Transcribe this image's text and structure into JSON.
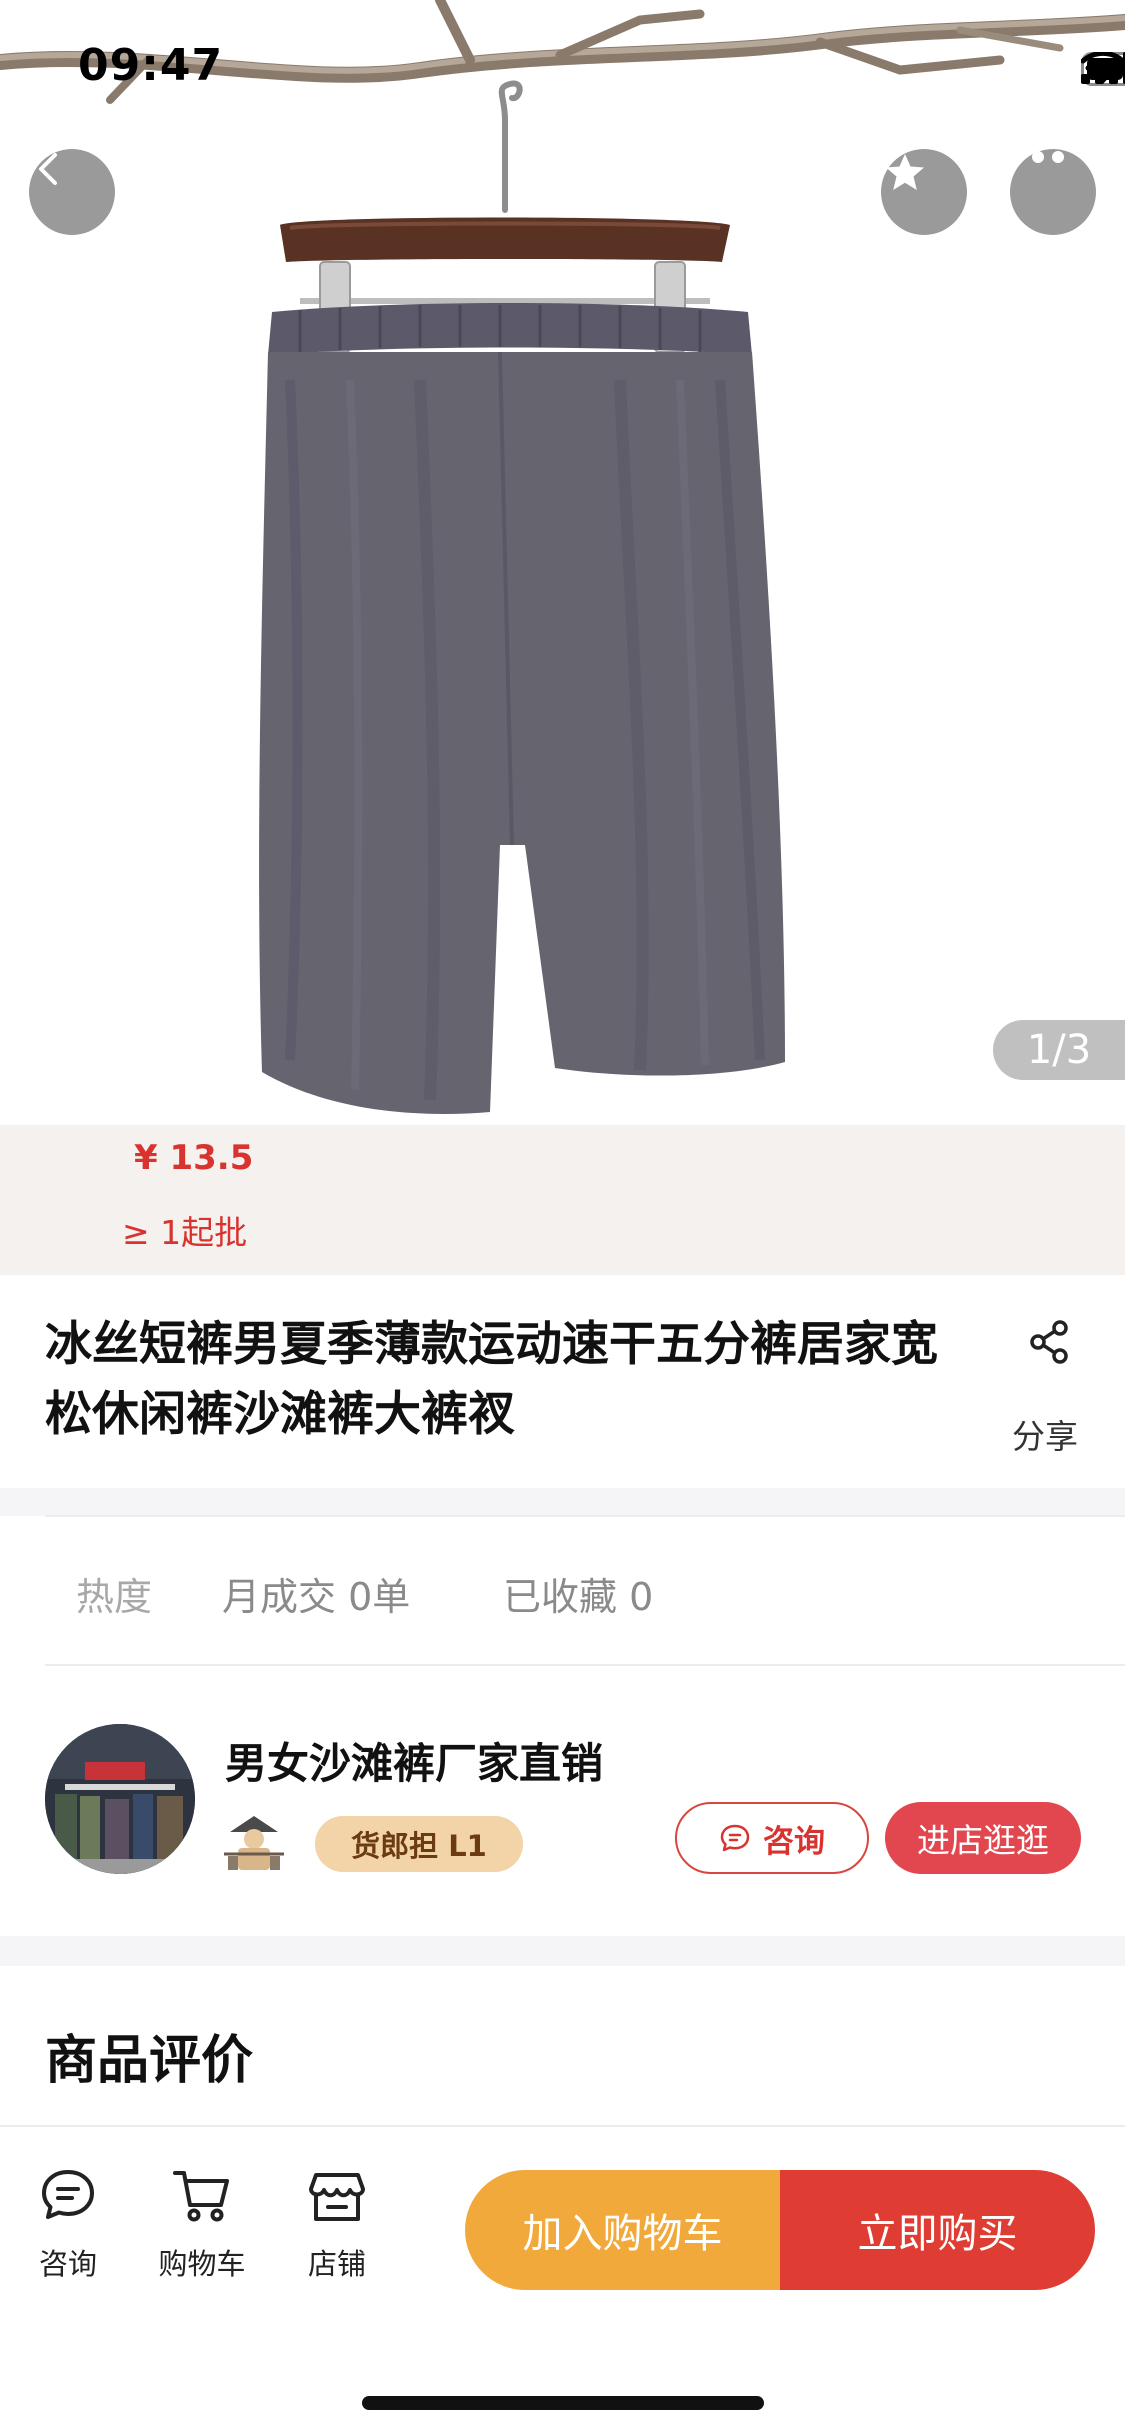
{
  "status_bar": {
    "time": "09:47",
    "icons": [
      "cellular-signal-icon",
      "wifi-icon",
      "battery-icon"
    ]
  },
  "gallery": {
    "counter": "1/3",
    "controls": [
      "back-arrow-icon",
      "star-favorite-icon",
      "more-dots-icon"
    ]
  },
  "price_section": {
    "price": "¥ 13.5",
    "min_order": "≥ 1起批"
  },
  "product": {
    "title": "冰丝短裤男夏季薄款运动速干五分裤居家宽松休闲裤沙滩裤大裤衩",
    "share_label": "分享"
  },
  "stats": {
    "heat_label": "热度",
    "monthly_deals": "月成交 0单",
    "favorites": "已收藏 0"
  },
  "shop": {
    "name": "男女沙滩裤厂家直销",
    "level_badge": "货郎担 L1",
    "consult_label": "咨询",
    "visit_label": "进店逛逛"
  },
  "reviews": {
    "title": "商品评价"
  },
  "bottom_bar": {
    "tabs": [
      {
        "label": "咨询",
        "icon": "chat-bubble-icon"
      },
      {
        "label": "购物车",
        "icon": "cart-icon"
      },
      {
        "label": "店铺",
        "icon": "store-icon"
      }
    ],
    "add_to_cart": "加入购物车",
    "buy_now": "立即购买"
  },
  "colors": {
    "accent_red": "#df3d33",
    "accent_orange": "#f2a93b",
    "price_red": "#d8332f",
    "badge_gold": "#f3d3a8"
  }
}
